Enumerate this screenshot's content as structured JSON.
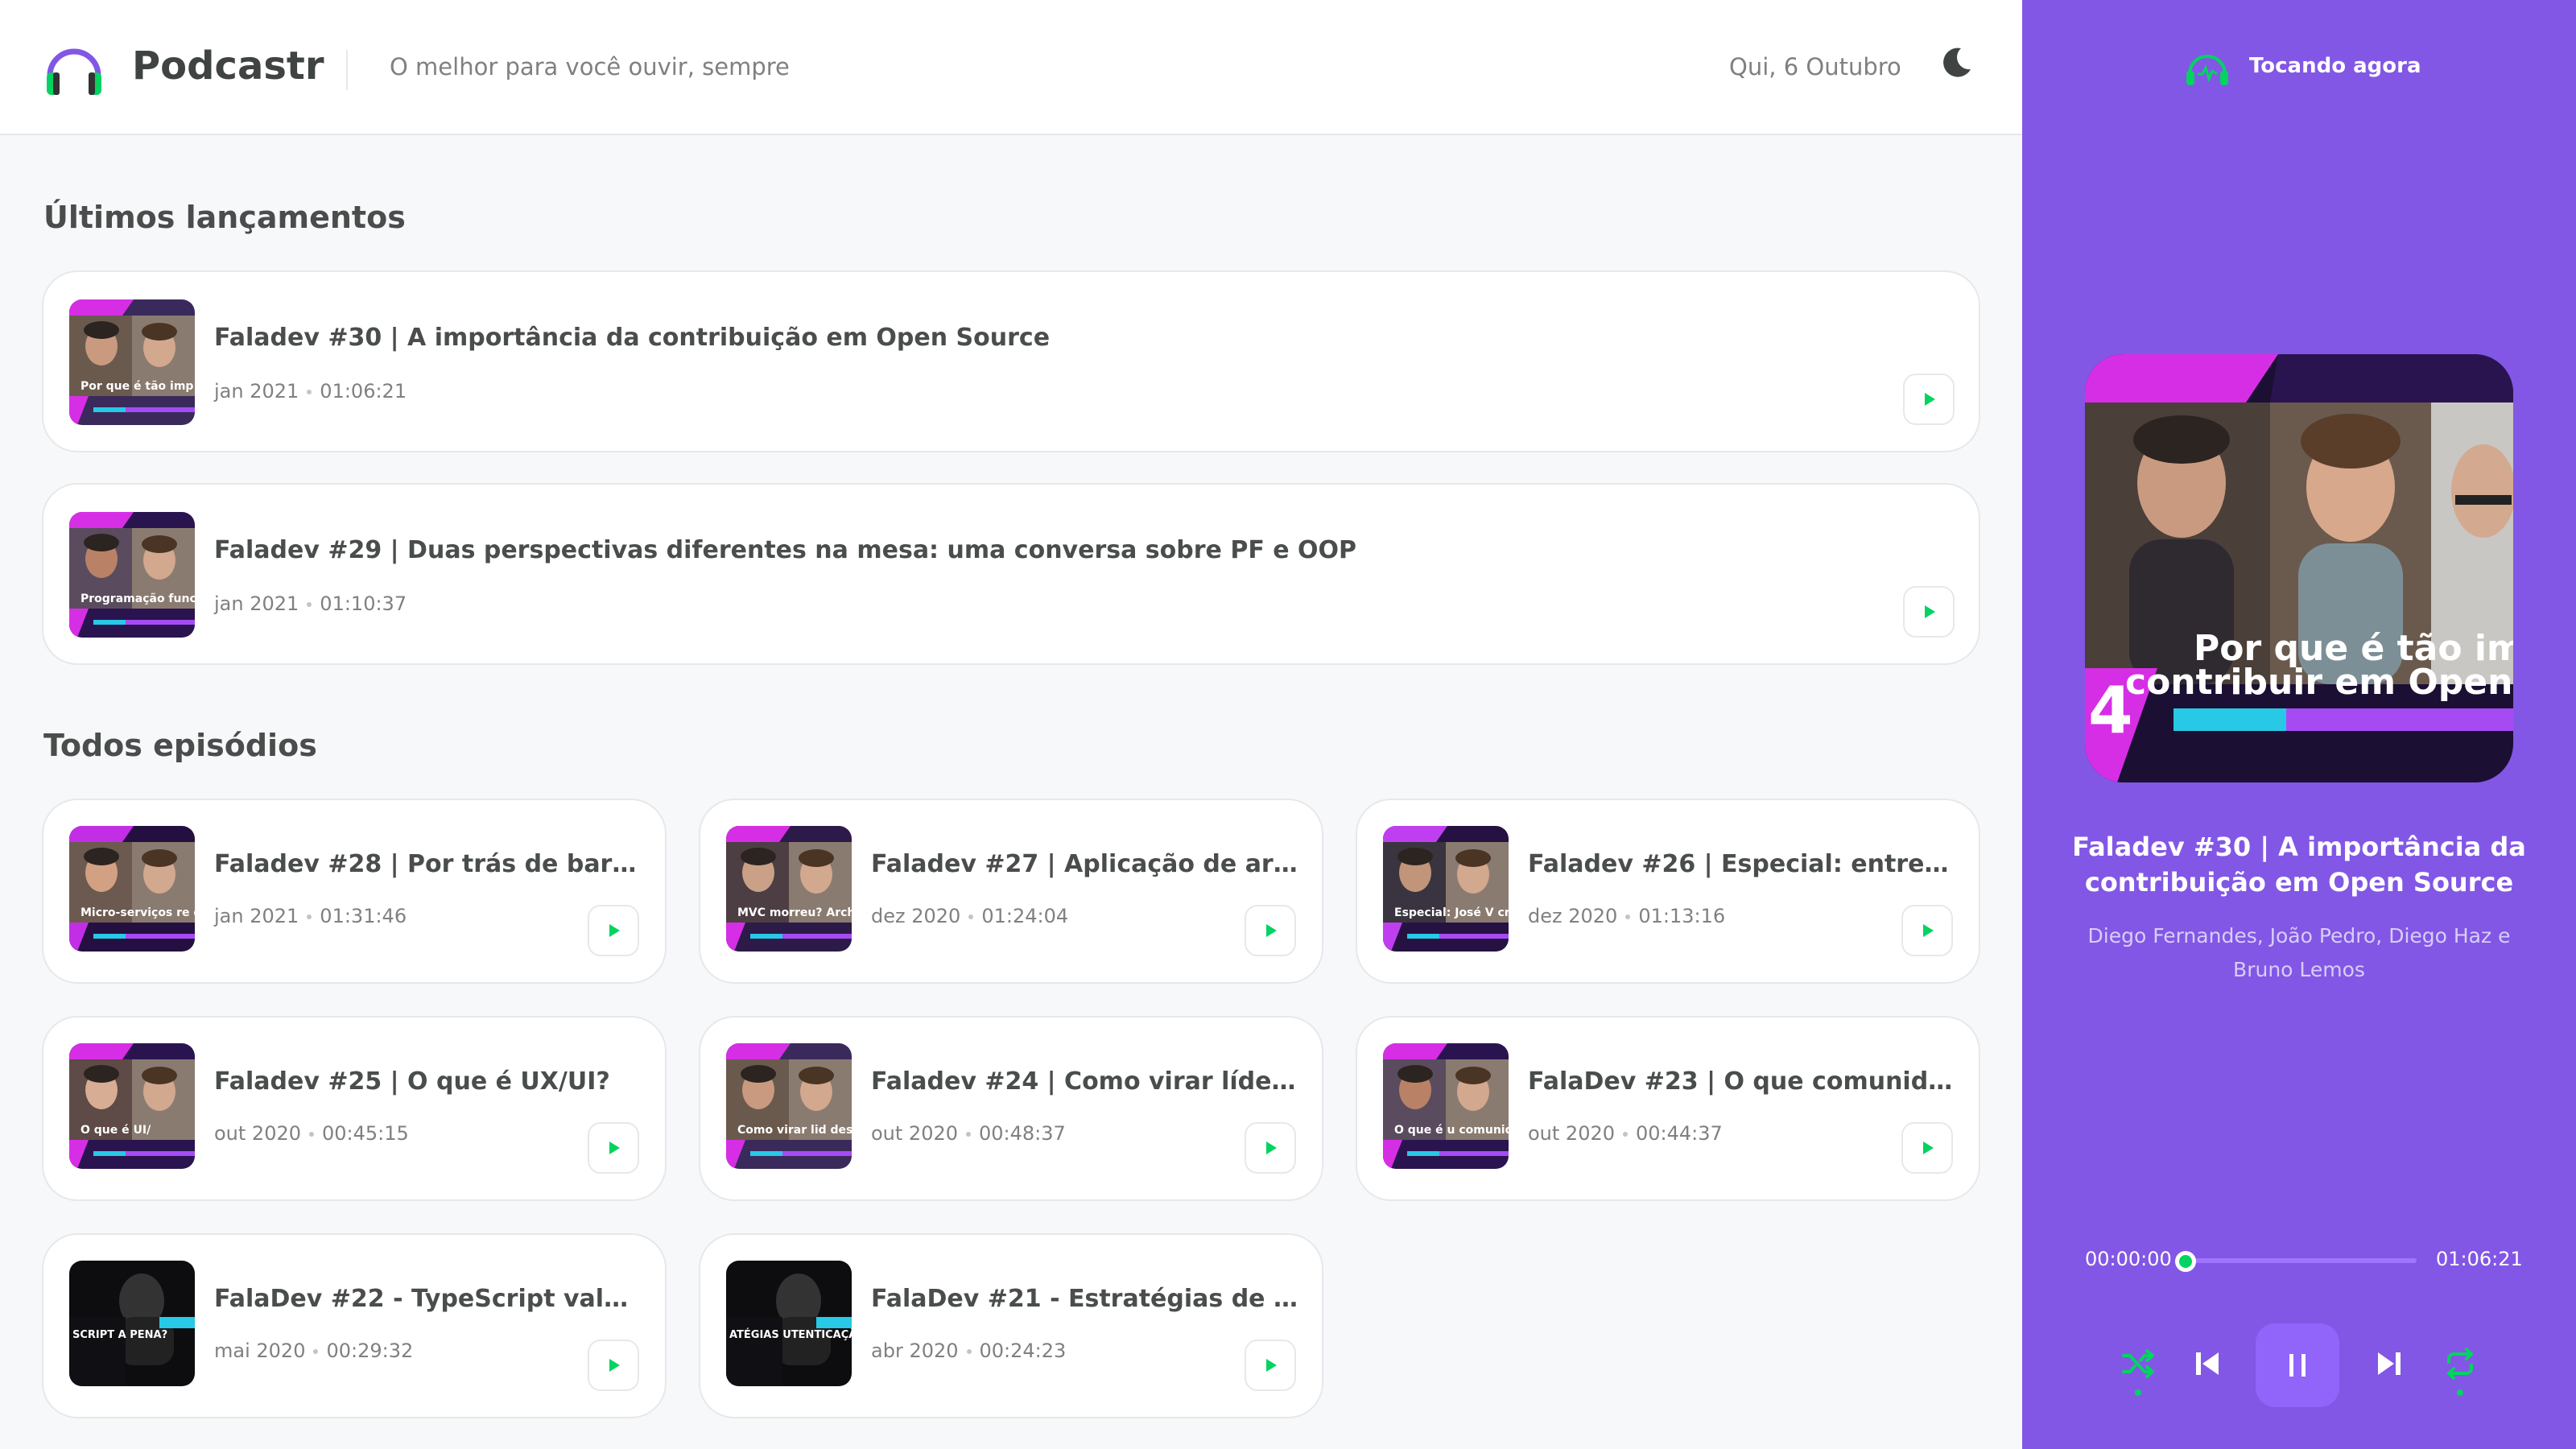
{
  "header": {
    "brand": "Podcastr",
    "tagline": "O melhor para você ouvir, sempre",
    "date": "Qui, 6 Outubro"
  },
  "sections": {
    "latest_title": "Últimos lançamentos",
    "all_title": "Todos episódios"
  },
  "latest": [
    {
      "title": "Faladev #30 | A importância da contribuição em Open Source",
      "date": "jan 2021",
      "duration": "01:06:21",
      "thumb_caption": "Por que é tão imp contribuir em Open S"
    },
    {
      "title": "Faladev #29 | Duas perspectivas diferentes na mesa: uma conversa sobre PF e OOP",
      "date": "jan 2021",
      "duration": "01:10:37",
      "thumb_caption": "Programação funcion devs orientados a o"
    }
  ],
  "episodes": [
    {
      "title": "Faladev #28 | Por trás de barreiras...",
      "date": "jan 2021",
      "duration": "01:31:46",
      "thumb_caption": "Micro-serviços re o que me"
    },
    {
      "title": "Faladev #27 | Aplicação de arquite...",
      "date": "dez 2020",
      "duration": "01:24:04",
      "thumb_caption": "MVC morreu? Architecture e"
    },
    {
      "title": "Faladev #26 | Especial: entrevista e...",
      "date": "dez 2020",
      "duration": "01:13:16",
      "thumb_caption": "Especial: José V criador do"
    },
    {
      "title": "Faladev #25 | O que é UX/UI?",
      "date": "out 2020",
      "duration": "00:45:15",
      "thumb_caption": "O que é UI/"
    },
    {
      "title": "Faladev #24 | Como virar líder de ...",
      "date": "out 2020",
      "duration": "00:48:37",
      "thumb_caption": "Como virar lid desenvolvime"
    },
    {
      "title": "FalaDev #23 | O que comunidades ...",
      "date": "out 2020",
      "duration": "00:44:37",
      "thumb_caption": "O que é u comunida"
    },
    {
      "title": "FalaDev #22 - TypeScript vale a pe...",
      "date": "mai 2020",
      "duration": "00:29:32",
      "thumb_caption": "SCRIPT A PENA?"
    },
    {
      "title": "FalaDev #21 - Estratégias de auten...",
      "date": "abr 2020",
      "duration": "00:24:23",
      "thumb_caption": "ATÉGIAS UTENTICAÇÃO OAUTH,"
    }
  ],
  "player": {
    "heading": "Tocando agora",
    "title": "Faladev #30 | A importância da contribuição em Open Source",
    "members": "Diego Fernandes, João Pedro, Diego Haz e Bruno Lemos",
    "cover_caption_1": "Por que é tão imp",
    "cover_caption_2": "contribuir em Open S",
    "current_time": "00:00:00",
    "total_time": "01:06:21",
    "progress": 0.0
  },
  "colors": {
    "brand_purple": "#8257e5",
    "accent_green": "#04d361",
    "text": "#494d4b",
    "muted": "#808080"
  },
  "icons": [
    "headphones-logo-icon",
    "moon-icon",
    "play-icon",
    "shuffle-icon",
    "previous-icon",
    "pause-icon",
    "next-icon",
    "repeat-icon"
  ]
}
